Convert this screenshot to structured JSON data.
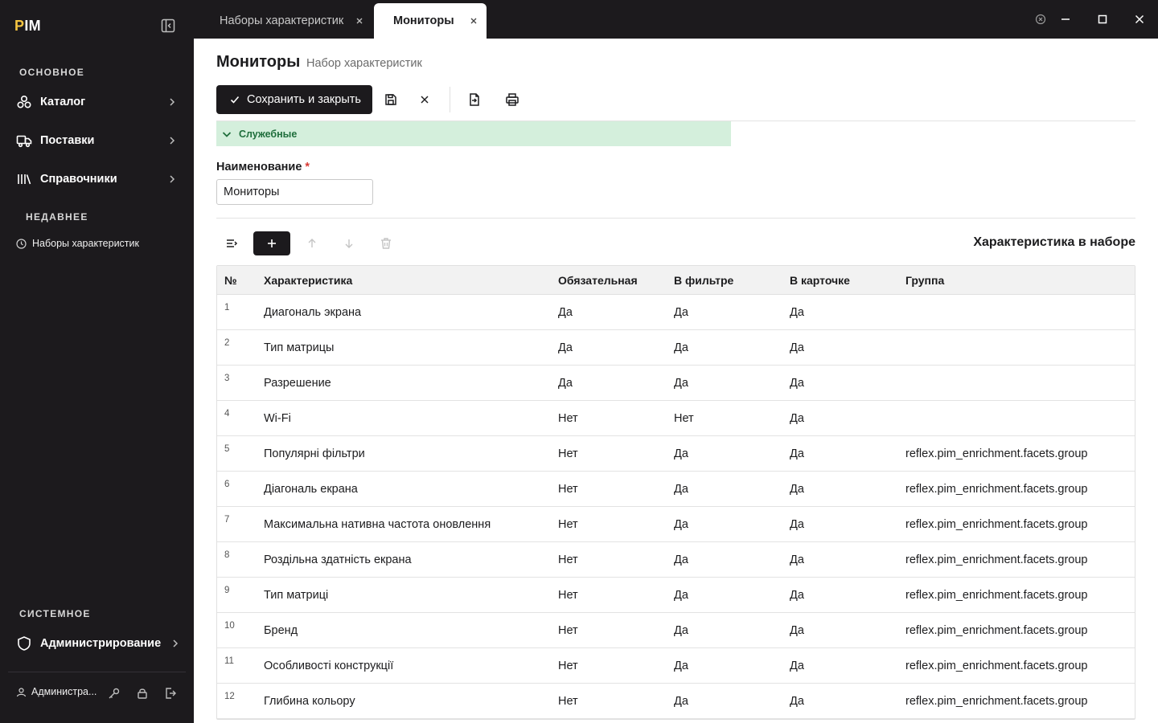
{
  "app": {
    "logo_p": "P",
    "logo_rest": "IM"
  },
  "sidebar": {
    "section_main": "ОСНОВНОЕ",
    "items": [
      {
        "label": "Каталог",
        "icon": "catalog-icon"
      },
      {
        "label": "Поставки",
        "icon": "truck-icon"
      },
      {
        "label": "Справочники",
        "icon": "library-icon"
      }
    ],
    "section_recent": "НЕДАВНЕЕ",
    "recent": [
      {
        "label": "Наборы характеристик",
        "icon": "clock-icon"
      }
    ],
    "section_system": "СИСТЕМНОЕ",
    "system_items": [
      {
        "label": "Администрирование",
        "icon": "shield-icon"
      }
    ],
    "user": {
      "name": "Администра..."
    }
  },
  "tabs": [
    {
      "label": "Наборы характеристик",
      "active": false
    },
    {
      "label": "Мониторы",
      "active": true
    }
  ],
  "page": {
    "title": "Мониторы",
    "subtitle": "Набор характеристик",
    "save_close": "Сохранить и закрыть",
    "group": "Служебные",
    "name_label": "Наименование",
    "required_mark": "*",
    "name_value": "Мониторы",
    "section_title": "Характеристика в наборе"
  },
  "table": {
    "headers": [
      "№",
      "Характеристика",
      "Обязательная",
      "В фильтре",
      "В карточке",
      "Группа"
    ],
    "rows": [
      [
        "1",
        "Диагональ экрана",
        "Да",
        "Да",
        "Да",
        ""
      ],
      [
        "2",
        "Тип матрицы",
        "Да",
        "Да",
        "Да",
        ""
      ],
      [
        "3",
        "Разрешение",
        "Да",
        "Да",
        "Да",
        ""
      ],
      [
        "4",
        "Wi-Fi",
        "Нет",
        "Нет",
        "Да",
        ""
      ],
      [
        "5",
        "Популярні фільтри",
        "Нет",
        "Да",
        "Да",
        "reflex.pim_enrichment.facets.group"
      ],
      [
        "6",
        "Діагональ екрана",
        "Нет",
        "Да",
        "Да",
        "reflex.pim_enrichment.facets.group"
      ],
      [
        "7",
        "Максимальна нативна частота оновлення",
        "Нет",
        "Да",
        "Да",
        "reflex.pim_enrichment.facets.group"
      ],
      [
        "8",
        "Роздільна здатність екрана",
        "Нет",
        "Да",
        "Да",
        "reflex.pim_enrichment.facets.group"
      ],
      [
        "9",
        "Тип матриці",
        "Нет",
        "Да",
        "Да",
        "reflex.pim_enrichment.facets.group"
      ],
      [
        "10",
        "Бренд",
        "Нет",
        "Да",
        "Да",
        "reflex.pim_enrichment.facets.group"
      ],
      [
        "11",
        "Особливості конструкції",
        "Нет",
        "Да",
        "Да",
        "reflex.pim_enrichment.facets.group"
      ],
      [
        "12",
        "Глибина кольору",
        "Нет",
        "Да",
        "Да",
        "reflex.pim_enrichment.facets.group"
      ]
    ]
  },
  "colors": {
    "dark": "#1c1a1d",
    "group_bg": "#d4efdc",
    "group_text": "#1f6e3c",
    "accent_logo": "#f5c542",
    "required": "#d83a34"
  }
}
